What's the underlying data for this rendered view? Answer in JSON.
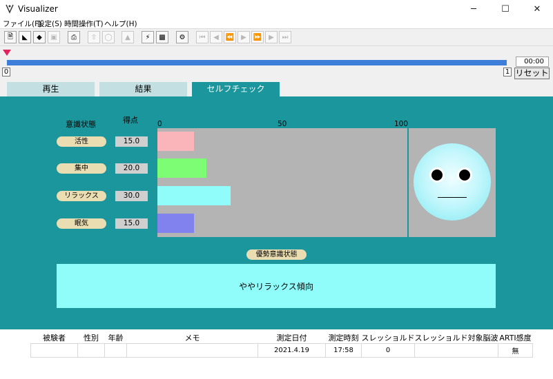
{
  "window": {
    "title": "Visualizer",
    "minimize": "─",
    "maximize": "☐",
    "close": "✕"
  },
  "menu": [
    "ファイル(F)",
    "設定(S)",
    "時間操作(T)",
    "ヘルプ(H)"
  ],
  "toolbar": {
    "icons": [
      "new-file-icon",
      "open-folder-icon",
      "layers-icon",
      "save-icon",
      "print-icon",
      "upload-icon",
      "shield-icon",
      "warning-icon",
      "lightning-icon",
      "chart-icon",
      "plug-icon"
    ],
    "transport": [
      "skip-start-icon",
      "step-back-icon",
      "rewind-icon",
      "play-icon",
      "fast-forward-icon",
      "step-forward-icon",
      "skip-end-icon"
    ]
  },
  "timeline": {
    "time": "00:00",
    "start_pos": "0",
    "end_pos": "1",
    "reset_label": "リセット",
    "progress": 1.0
  },
  "tabs": [
    {
      "label": "再生",
      "active": false
    },
    {
      "label": "結果",
      "active": false
    },
    {
      "label": "セルフチェック",
      "active": true
    }
  ],
  "selfcheck": {
    "state_header": "意識状態",
    "score_header": "得点",
    "dominant_label": "優勢意識状態",
    "result_text": "ややリラックス傾向"
  },
  "chart_data": {
    "type": "bar",
    "orientation": "horizontal",
    "x_ticks": [
      "0",
      "50",
      "100"
    ],
    "xlim": [
      0,
      100
    ],
    "categories": [
      "活性",
      "集中",
      "リラックス",
      "眠気"
    ],
    "values": [
      15.0,
      20.0,
      30.0,
      15.0
    ],
    "value_labels": [
      "15.0",
      "20.0",
      "30.0",
      "15.0"
    ],
    "colors": [
      "#f9b5b9",
      "#7dfd74",
      "#90fdfb",
      "#8282ef"
    ]
  },
  "info_table": {
    "headers": [
      "被験者",
      "性別",
      "年齢",
      "メモ",
      "測定日付",
      "測定時刻",
      "スレッショルド",
      "スレッショルド対象脳波",
      "ARTI感度"
    ],
    "row": [
      "",
      "",
      "",
      "",
      "2021.4.19",
      "17:58",
      "0",
      "",
      "無"
    ]
  }
}
